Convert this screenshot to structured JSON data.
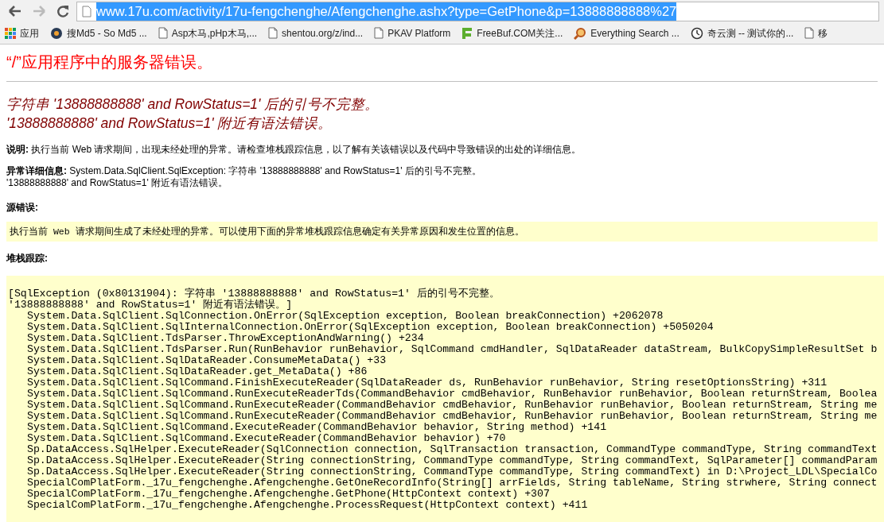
{
  "address_bar": {
    "value": "www.17u.com/activity/17u-fengchenghe/Afengchenghe.ashx?type=GetPhone&p=13888888888%27",
    "selected": true
  },
  "bookmarks": [
    {
      "kind": "apps",
      "label": "应用"
    },
    {
      "kind": "disc",
      "label": "搜Md5 - So Md5 ..."
    },
    {
      "kind": "page",
      "label": "Asp木马,pHp木马,..."
    },
    {
      "kind": "page",
      "label": "shentou.org/z/ind..."
    },
    {
      "kind": "page",
      "label": "PKAV Platform"
    },
    {
      "kind": "flag",
      "label": "FreeBuf.COM关注..."
    },
    {
      "kind": "lens",
      "label": "Everything Search ..."
    },
    {
      "kind": "timer",
      "label": "奇云测 -- 测试你的..."
    },
    {
      "kind": "page",
      "label": "移"
    }
  ],
  "error_page": {
    "title": "“/”应用程序中的服务器错误。",
    "message_lines": [
      "字符串 '13888888888' and RowStatus=1' 后的引号不完整。",
      "'13888888888' and RowStatus=1' 附近有语法错误。"
    ],
    "description": {
      "label": "说明:",
      "text": "执行当前 Web 请求期间，出现未经处理的异常。请检查堆栈跟踪信息，以了解有关该错误以及代码中导致错误的出处的详细信息。"
    },
    "exception_details": {
      "label": "异常详细信息:",
      "lines": [
        "System.Data.SqlClient.SqlException: 字符串 '13888888888' and RowStatus=1' 后的引号不完整。",
        "'13888888888' and RowStatus=1' 附近有语法错误。"
      ]
    },
    "source_error": {
      "label": "源错误:",
      "text": "执行当前 Web 请求期间生成了未经处理的异常。可以使用下面的异常堆栈跟踪信息确定有关异常原因和发生位置的信息。"
    },
    "stack_trace": {
      "label": "堆栈跟踪:",
      "message": [
        "[SqlException (0x80131904): 字符串 '13888888888' and RowStatus=1' 后的引号不完整。",
        "'13888888888' and RowStatus=1' 附近有语法错误。]"
      ],
      "frames": [
        "System.Data.SqlClient.SqlConnection.OnError(SqlException exception, Boolean breakConnection) +2062078",
        "System.Data.SqlClient.SqlInternalConnection.OnError(SqlException exception, Boolean breakConnection) +5050204",
        "System.Data.SqlClient.TdsParser.ThrowExceptionAndWarning() +234",
        "System.Data.SqlClient.TdsParser.Run(RunBehavior runBehavior, SqlCommand cmdHandler, SqlDataReader dataStream, BulkCopySimpleResultSet b",
        "System.Data.SqlClient.SqlDataReader.ConsumeMetaData() +33",
        "System.Data.SqlClient.SqlDataReader.get_MetaData() +86",
        "System.Data.SqlClient.SqlCommand.FinishExecuteReader(SqlDataReader ds, RunBehavior runBehavior, String resetOptionsString) +311",
        "System.Data.SqlClient.SqlCommand.RunExecuteReaderTds(CommandBehavior cmdBehavior, RunBehavior runBehavior, Boolean returnStream, Boolea",
        "System.Data.SqlClient.SqlCommand.RunExecuteReader(CommandBehavior cmdBehavior, RunBehavior runBehavior, Boolean returnStream, String me",
        "System.Data.SqlClient.SqlCommand.RunExecuteReader(CommandBehavior cmdBehavior, RunBehavior runBehavior, Boolean returnStream, String me",
        "System.Data.SqlClient.SqlCommand.ExecuteReader(CommandBehavior behavior, String method) +141",
        "System.Data.SqlClient.SqlCommand.ExecuteReader(CommandBehavior behavior) +70",
        "Sp.DataAccess.SqlHelper.ExecuteReader(SqlConnection connection, SqlTransaction transaction, CommandType commandType, String commandText",
        "Sp.DataAccess.SqlHelper.ExecuteReader(String connectionString, CommandType commandType, String commandText, SqlParameter[] commandParam",
        "Sp.DataAccess.SqlHelper.ExecuteReader(String connectionString, CommandType commandType, String commandText) in D:\\Project_LDL\\SpecialCo",
        "SpecialComPlatForm._17u_fengchenghe.Afengchenghe.GetOneRecordInfo(String[] arrFields, String tableName, String strwhere, String connect",
        "SpecialComPlatForm._17u_fengchenghe.Afengchenghe.GetPhone(HttpContext context) +307",
        "SpecialComPlatForm._17u_fengchenghe.Afengchenghe.ProcessRequest(HttpContext context) +411"
      ]
    }
  }
}
